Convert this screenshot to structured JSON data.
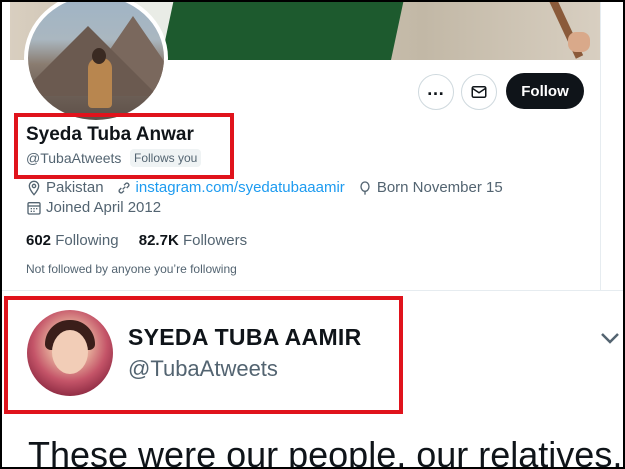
{
  "profile": {
    "name": "Syeda Tuba Anwar",
    "handle": "@TubaAtweets",
    "follows_you": "Follows you",
    "location": "Pakistan",
    "website": "instagram.com/syedatubaaamir",
    "born": "Born November 15",
    "joined": "Joined April 2012",
    "following_count": "602",
    "following_label": "Following",
    "followers_count": "82.7K",
    "followers_label": "Followers",
    "not_followed": "Not followed by anyone you’re following",
    "follow_button": "Follow",
    "more_icon": "more-icon",
    "mail_icon": "mail-icon"
  },
  "tweet": {
    "name": "SYEDA TUBA AAMIR",
    "handle": "@TubaAtweets",
    "text": "These were our people, our relatives,",
    "menu_icon": "chevron-down-icon"
  },
  "colors": {
    "highlight": "#e0131c",
    "link": "#1d9bf0",
    "button": "#0f1419",
    "secondary_text": "#536471"
  }
}
